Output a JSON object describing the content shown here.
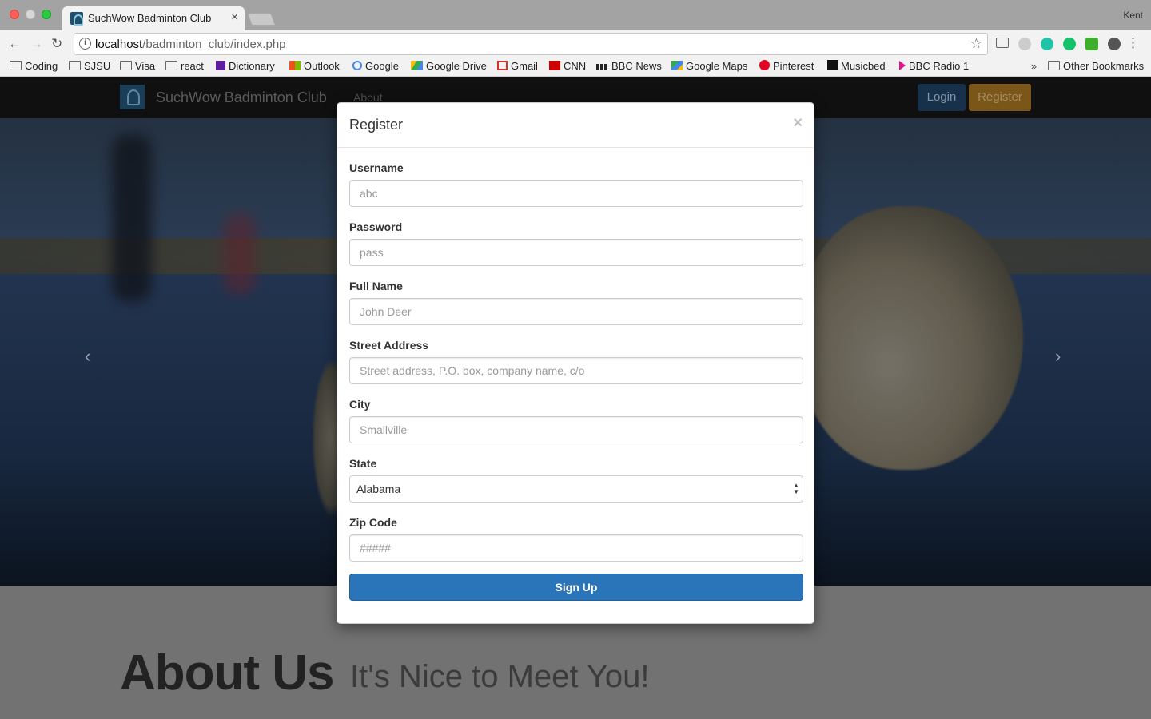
{
  "browser": {
    "tab_title": "SuchWow Badminton Club",
    "tab_close": "×",
    "profile_name": "Kent",
    "url_host": "localhost",
    "url_path": "/badminton_club/index.php",
    "bookmarks": [
      "Coding",
      "SJSU",
      "Visa",
      "react",
      "Dictionary",
      "Outlook",
      "Google",
      "Google Drive",
      "Gmail",
      "CNN",
      "BBC News",
      "Google Maps",
      "Pinterest",
      "Musicbed",
      "BBC Radio 1"
    ],
    "bookmarks_overflow": "»",
    "other_bookmarks": "Other Bookmarks"
  },
  "site": {
    "brand": "SuchWow Badminton Club",
    "nav_about": "About",
    "login_label": "Login",
    "register_label": "Register",
    "hero_prev": "‹",
    "hero_next": "›",
    "about_title": "About Us",
    "about_subtitle": "It's Nice to Meet You!"
  },
  "modal": {
    "title": "Register",
    "close": "×",
    "fields": [
      {
        "label": "Username",
        "placeholder": "abc"
      },
      {
        "label": "Password",
        "placeholder": "pass"
      },
      {
        "label": "Full Name",
        "placeholder": "John Deer"
      },
      {
        "label": "Street Address",
        "placeholder": "Street address, P.O. box, company name, c/o"
      },
      {
        "label": "City",
        "placeholder": "Smallville"
      }
    ],
    "state_label": "State",
    "state_value": "Alabama",
    "zip_label": "Zip Code",
    "zip_placeholder": "#####",
    "submit_label": "Sign Up"
  },
  "colors": {
    "primary": "#2a74ba",
    "warning": "#7a5718",
    "navbar": "#101010"
  }
}
